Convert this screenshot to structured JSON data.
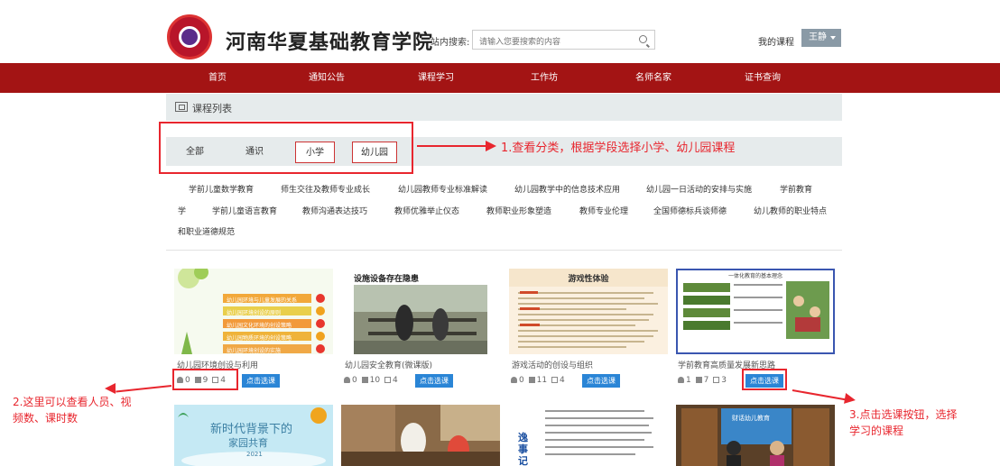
{
  "header": {
    "site_title": "河南华夏基础教育学院",
    "search_label": "站内搜索:",
    "search_placeholder": "请输入您要搜索的内容",
    "my_course": "我的课程",
    "user_name": "王静"
  },
  "nav": [
    "首页",
    "通知公告",
    "课程学习",
    "工作坊",
    "名师名家",
    "证书查询"
  ],
  "list_title": "课程列表",
  "filters": [
    "全部",
    "通识",
    "小学",
    "幼儿园"
  ],
  "tags": [
    "学前儿童数学教育",
    "师生交往及教师专业成长",
    "幼儿园教师专业标准解读",
    "幼儿园教学中的信息技术应用",
    "幼儿园一日活动的安排与实施",
    "学前教育",
    "学",
    "学前儿童语言教育",
    "教师沟通表达技巧",
    "教师优雅举止仪态",
    "教师职业形象塑造",
    "教师专业伦理",
    "全国师德标兵谈师德",
    "幼儿教师的职业特点",
    "和职业道德规范"
  ],
  "courses": [
    {
      "title": "幼儿园环境创设与利用",
      "people": "0",
      "videos": "9",
      "hours": "4",
      "button": "点击选课",
      "img_lines": [
        "幼儿园环境与儿童发展的关系",
        "幼儿园环境创设的原则",
        "幼儿园文化环境的创设策略",
        "幼儿园物质环境的创设策略",
        "幼儿园环境创设的实施"
      ]
    },
    {
      "title": "幼儿园安全教育(微课版)",
      "people": "0",
      "videos": "10",
      "hours": "4",
      "button": "点击选课",
      "img_lines": [
        "设施设备存在隐患"
      ]
    },
    {
      "title": "游戏活动的创设与组织",
      "people": "0",
      "videos": "11",
      "hours": "4",
      "button": "点击选课",
      "img_lines": [
        "游戏性体验"
      ]
    },
    {
      "title": "学前教育高质量发展新思路",
      "people": "1",
      "videos": "7",
      "hours": "3",
      "button": "点击选课",
      "img_lines": [
        "一体化教育的基本理念"
      ]
    }
  ],
  "second_row": {
    "card1_title": "新时代背景下的",
    "card1_sub": "家园共育",
    "card1_year": "2021",
    "card3_title": "逸事记录",
    "card4_title": "财话幼儿教育"
  },
  "annotations": {
    "a1": "1.查看分类，根据学段选择小学、幼儿园课程",
    "a2_line1": "2.这里可以查看人员、视",
    "a2_line2": "频数、课时数",
    "a3_line1": "3.点击选课按钮，选择",
    "a3_line2": "学习的课程"
  },
  "colors": {
    "nav_bg": "#a31414",
    "annotation": "#e8262e",
    "button": "#2a85d6"
  }
}
